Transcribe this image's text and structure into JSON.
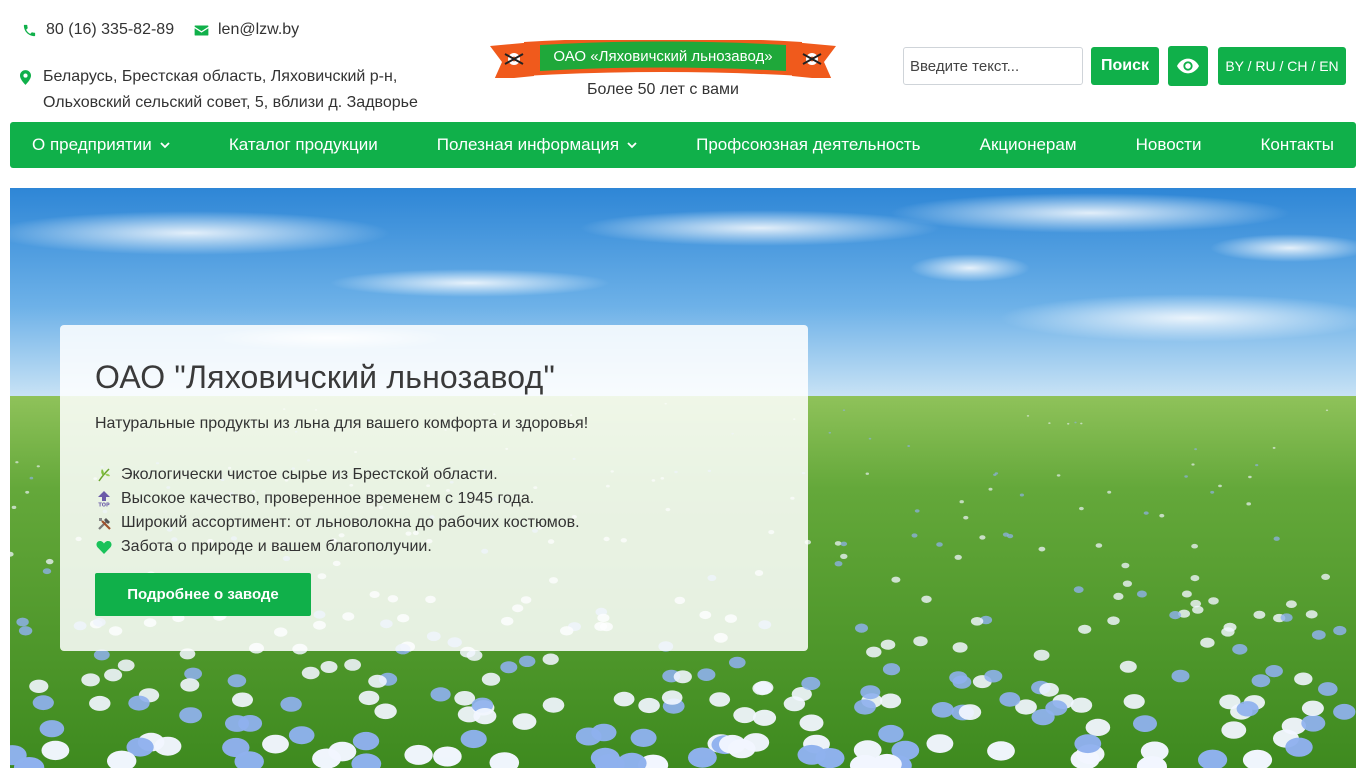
{
  "header": {
    "phone": "80 (16) 335-82-89",
    "email": "len@lzw.by",
    "address_line1": "Беларусь, Брестская область, Ляховичский р-н,",
    "address_line2": "Ольховский сельский совет, 5, вблизи д. Задворье",
    "logo_text": "ОАО «Ляховичский льнозавод»",
    "tagline": "Более 50 лет с вами",
    "search_placeholder": "Введите текст...",
    "search_label": "Поиск",
    "languages": "BY / RU / CH / EN"
  },
  "nav": {
    "items": [
      {
        "label": "О предприятии",
        "has_dropdown": true
      },
      {
        "label": "Каталог продукции",
        "has_dropdown": false
      },
      {
        "label": "Полезная информация",
        "has_dropdown": true
      },
      {
        "label": "Профсоюзная деятельность",
        "has_dropdown": false
      },
      {
        "label": "Акционерам",
        "has_dropdown": false
      },
      {
        "label": "Новости",
        "has_dropdown": false
      },
      {
        "label": "Контакты",
        "has_dropdown": false
      }
    ]
  },
  "hero": {
    "title": "ОАО \"Ляховичский льнозавод\"",
    "subtitle": "Натуральные продукты из льна для вашего комфорта и здоровья!",
    "features": [
      {
        "icon": "herb-icon",
        "text": "Экологически чистое сырье из Брестской области."
      },
      {
        "icon": "top-arrow-icon",
        "text": "Высокое качество, проверенное временем с 1945 года."
      },
      {
        "icon": "tools-icon",
        "text": "Широкий ассортимент: от льноволокна до рабочих костюмов."
      },
      {
        "icon": "green-heart-icon",
        "text": "Забота о природе и вашем благополучии."
      }
    ],
    "button_label": "Подробнее о заводе"
  },
  "colors": {
    "brand_green": "#10b04a",
    "ribbon_orange": "#f05a1c",
    "ribbon_green": "#1fa83a"
  }
}
